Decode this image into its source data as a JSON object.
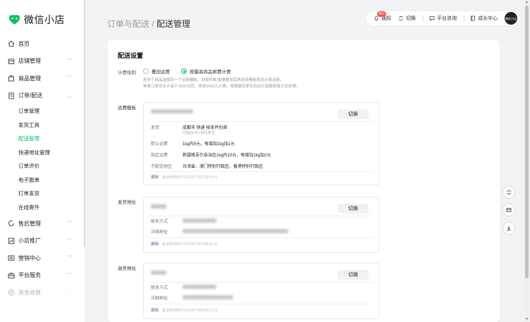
{
  "app": {
    "name": "微信小店"
  },
  "sidebar": {
    "items": [
      {
        "label": "首页",
        "icon": "home-icon"
      },
      {
        "label": "店铺管理",
        "icon": "shop-icon"
      },
      {
        "label": "商品管理",
        "icon": "bag-icon"
      },
      {
        "label": "订单/配送",
        "icon": "document-icon"
      },
      {
        "label": "售后管理",
        "icon": "refresh-icon"
      },
      {
        "label": "小店推广",
        "icon": "chart-icon"
      },
      {
        "label": "营销中心",
        "icon": "coupon-icon"
      },
      {
        "label": "平台服务",
        "icon": "briefcase-icon"
      },
      {
        "label": "资金结算",
        "icon": "yuan-icon"
      }
    ],
    "order_sub": [
      "订单管理",
      "发货工具",
      "配送管理",
      "快递地址管理",
      "订单评价",
      "电子面单",
      "打单发货",
      "在线寄件"
    ]
  },
  "header": {
    "crumb_parent": "订单与配送",
    "crumb_sep": "/",
    "crumb_current": "配送管理",
    "toolbar": {
      "notify": "通知",
      "notify_badge": "99+",
      "switch": "切换",
      "service": "平台咨询",
      "growth": "成长中心",
      "avatar_text": "微信小店"
    }
  },
  "settings": {
    "title": "配送设置",
    "billing_label": "计费规则",
    "option1": "叠加运费",
    "option2": "按最高商品邮费计费",
    "note1": "若多个商品选择同一个运费模板，则按件数/重量叠加后再按该模板规则计算运费。",
    "note2": "单笔订单总合计高于1000元的，将按1000元计算。将根据买家实际支付金额按每方式处理。",
    "template": {
      "label": "运费模板",
      "button": "切换",
      "ship_label": "发货",
      "ship_value": "成都市 快递 按条件包邮",
      "ship_sub": "付款后24小时内发货",
      "default_label": "默认运费",
      "default_value": "1kg内5元，每增加1kg加1元",
      "special_label": "指定运费",
      "special_value": "新疆维吾尔自治区1kg内10元，每增加1kg加2元",
      "nodelivery_label": "不配送地区",
      "nodelivery_value": "台湾省、澳门特别行政区、香港特别行政区",
      "edit": "编辑",
      "updated": "最近修改时间 2023年7月21日16:41"
    },
    "ship_address": {
      "label": "发货地址",
      "button": "切换",
      "contact_label": "联系方式",
      "address_label": "详细地址",
      "edit": "编辑",
      "updated": "最近修改时间 2023年7月24日15:10"
    },
    "return_address": {
      "label": "退货地址",
      "button": "切换",
      "contact_label": "联系方式",
      "address_label": "详细地址",
      "edit": "编辑",
      "updated": "最近修改时间 2023年7月25日17:23"
    }
  },
  "colors": {
    "accent": "#07c160",
    "badge": "#fa5151",
    "link": "#576b95"
  }
}
